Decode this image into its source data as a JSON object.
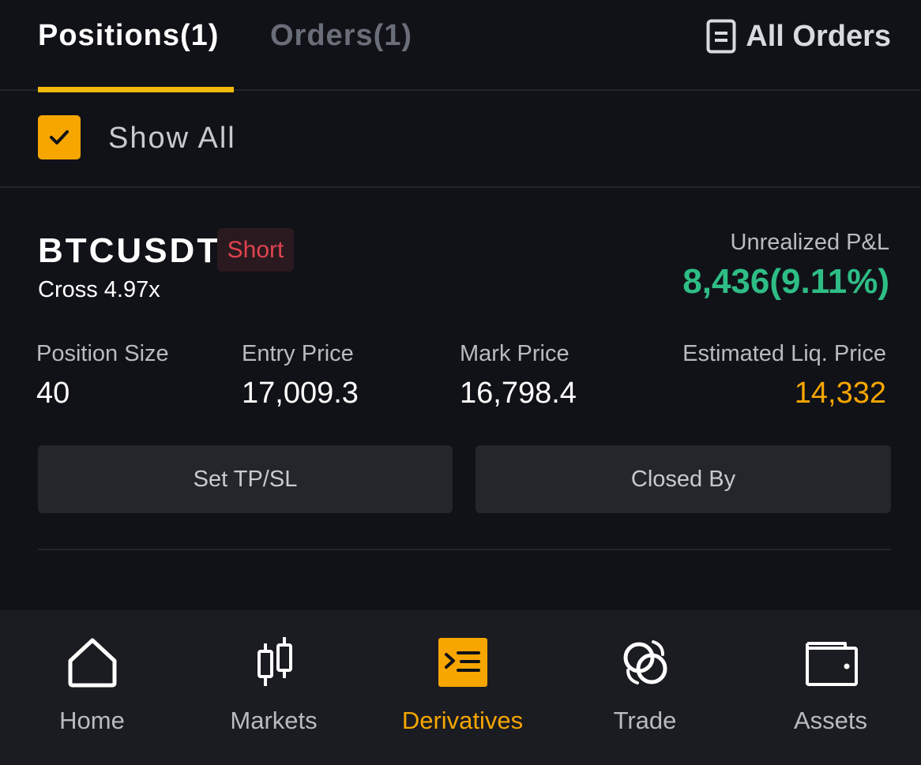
{
  "tabs": {
    "positions_label": "Positions(1)",
    "orders_label": "Orders(1)",
    "all_orders_label": "All Orders"
  },
  "filter": {
    "show_all_label": "Show All",
    "show_all_checked": true
  },
  "position": {
    "symbol": "BTCUSDT",
    "side": "Short",
    "margin_mode": "Cross 4.97x",
    "unrealized_pnl_label": "Unrealized P&L",
    "unrealized_pnl_value": "8,436(9.11%)",
    "metrics": [
      {
        "label": "Position Size",
        "value": "40"
      },
      {
        "label": "Entry Price",
        "value": "17,009.3"
      },
      {
        "label": "Mark Price",
        "value": "16,798.4"
      },
      {
        "label": "Estimated Liq. Price",
        "value": "14,332"
      }
    ],
    "buttons": {
      "set_tpsl": "Set TP/SL",
      "closed_by": "Closed By"
    }
  },
  "bottom_nav": {
    "items": [
      {
        "label": "Home",
        "icon": "home-icon"
      },
      {
        "label": "Markets",
        "icon": "candlestick-icon"
      },
      {
        "label": "Derivatives",
        "icon": "derivatives-icon",
        "active": true
      },
      {
        "label": "Trade",
        "icon": "trade-icon"
      },
      {
        "label": "Assets",
        "icon": "wallet-icon"
      }
    ]
  },
  "colors": {
    "background": "#111218",
    "accent": "#f7a600",
    "positive": "#2ebd85",
    "negative": "#e0434f",
    "liquidation": "#f7a600"
  }
}
